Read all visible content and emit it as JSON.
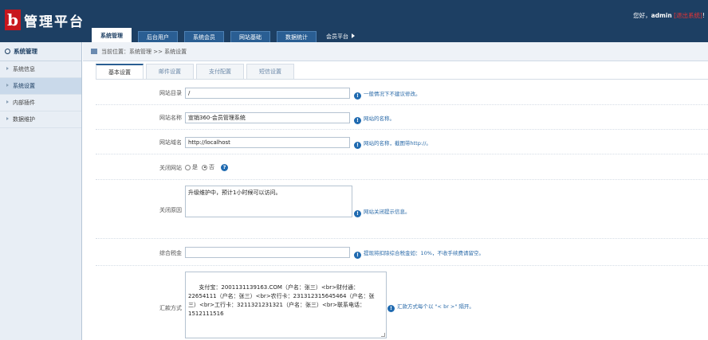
{
  "header": {
    "logo_letter": "b",
    "logo_text": "管理平台",
    "welcome_prefix": "您好，",
    "username": "admin",
    "exit_label": "[退出系统]",
    "welcome_suffix": "!",
    "bg_color": "#1d3f63"
  },
  "nav": {
    "tabs": [
      {
        "label": "系统管理",
        "active": true
      },
      {
        "label": "后台用户",
        "active": false
      },
      {
        "label": "系统会员",
        "active": false
      },
      {
        "label": "网站基础",
        "active": false
      },
      {
        "label": "数据统计",
        "active": false
      }
    ],
    "more_label": "会员平台"
  },
  "sidebar": {
    "title": "系统管理",
    "items": [
      {
        "label": "系统信息",
        "active": false
      },
      {
        "label": "系统设置",
        "active": true
      },
      {
        "label": "内部插件",
        "active": false
      },
      {
        "label": "数据维护",
        "active": false
      }
    ]
  },
  "breadcrumb": {
    "text": "当前位置：系统管理 >> 系统设置"
  },
  "tabs": [
    {
      "label": "基本设置",
      "active": true
    },
    {
      "label": "邮件设置",
      "active": false
    },
    {
      "label": "支付配置",
      "active": false
    },
    {
      "label": "短信设置",
      "active": false
    }
  ],
  "form": {
    "site_dir": {
      "label": "网站目录",
      "value": "/",
      "hint": "一般情况下不建议修改。"
    },
    "site_name": {
      "label": "网站名称",
      "value": "宣销360-会员管理系统",
      "hint": "网站的名称。"
    },
    "site_domain": {
      "label": "网站域名",
      "value": "http://localhost",
      "hint": "网站的名称，截图带http://。"
    },
    "close_site": {
      "label": "关闭网站",
      "options": [
        "是",
        "否"
      ],
      "selected": "否"
    },
    "close_reason": {
      "label": "关闭原因",
      "value": "升级维护中，预计1小时候可以访问。",
      "hint": "网站关闭提示信息。"
    },
    "tax": {
      "label": "综合税金",
      "value": "",
      "hint": "提现将扣除综合税金如：10%，不收手续费请留空。"
    },
    "remit": {
      "label": "汇款方式",
      "value": "支付宝：2001131139163.COM（户名：张三）<br>财付通：\n22654111（户名：张三）<br>农行卡：231312315645464（户名：张\n三）<br>工行卡：3211321231321（户名：张三）<br>联系电话：\n1512111516",
      "hint": "汇款方式每个以 \"< br >\" 隔开。"
    }
  }
}
